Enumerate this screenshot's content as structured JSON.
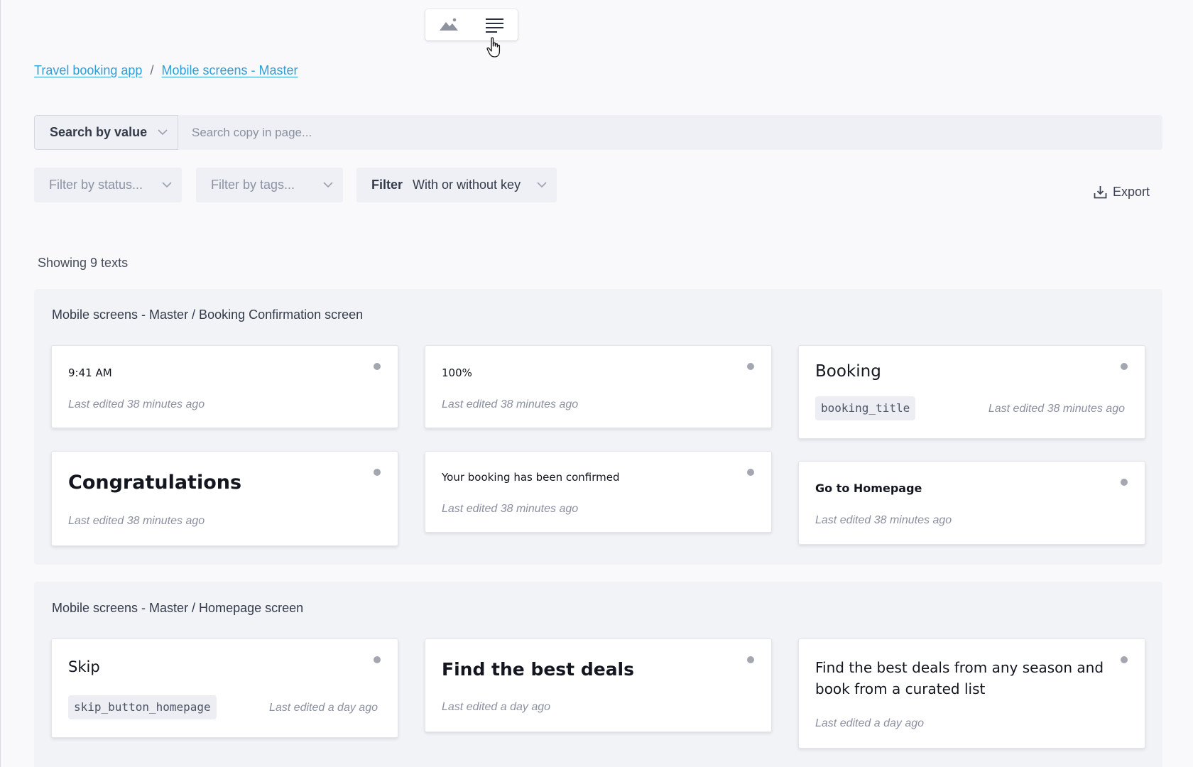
{
  "breadcrumb": {
    "project": "Travel booking app",
    "page": "Mobile screens - Master",
    "separator": "/"
  },
  "search": {
    "mode": "Search by value",
    "placeholder": "Search copy in page...",
    "value": ""
  },
  "filters": {
    "status_placeholder": "Filter by status...",
    "tags_placeholder": "Filter by tags...",
    "key_label": "Filter",
    "key_value": "With or without key"
  },
  "export_label": "Export",
  "count_text": "Showing 9 texts",
  "groups": [
    {
      "title": "Mobile screens - Master / Booking Confirmation screen",
      "cards": [
        {
          "text": "9:41 AM",
          "meta": "Last edited 38 minutes ago"
        },
        {
          "text": "100%",
          "meta": "Last edited 38 minutes ago"
        },
        {
          "text": "Booking",
          "key": "booking_title",
          "meta": "Last edited 38 minutes ago"
        },
        {
          "text": "Congratulations",
          "meta": "Last edited 38 minutes ago"
        },
        {
          "text": "Your booking has been confirmed",
          "meta": "Last edited 38 minutes ago"
        },
        {
          "text": "Go to Homepage",
          "meta": "Last edited 38 minutes ago"
        }
      ]
    },
    {
      "title": "Mobile screens - Master / Homepage screen",
      "cards": [
        {
          "text": "Skip",
          "key": "skip_button_homepage",
          "meta": "Last edited a day ago"
        },
        {
          "text": "Find the best deals",
          "meta": "Last edited a day ago"
        },
        {
          "text": "Find the best deals from any season and book from a curated list",
          "meta": "Last edited a day ago"
        }
      ]
    }
  ],
  "icons": {
    "image_view": "image-icon",
    "text_view": "text-lines-icon",
    "export": "download-icon",
    "status": "status-dot-icon"
  },
  "colors": {
    "link": "#2f9fd6",
    "background": "#f9f9fc",
    "status_dot": "#a4a7b0"
  }
}
